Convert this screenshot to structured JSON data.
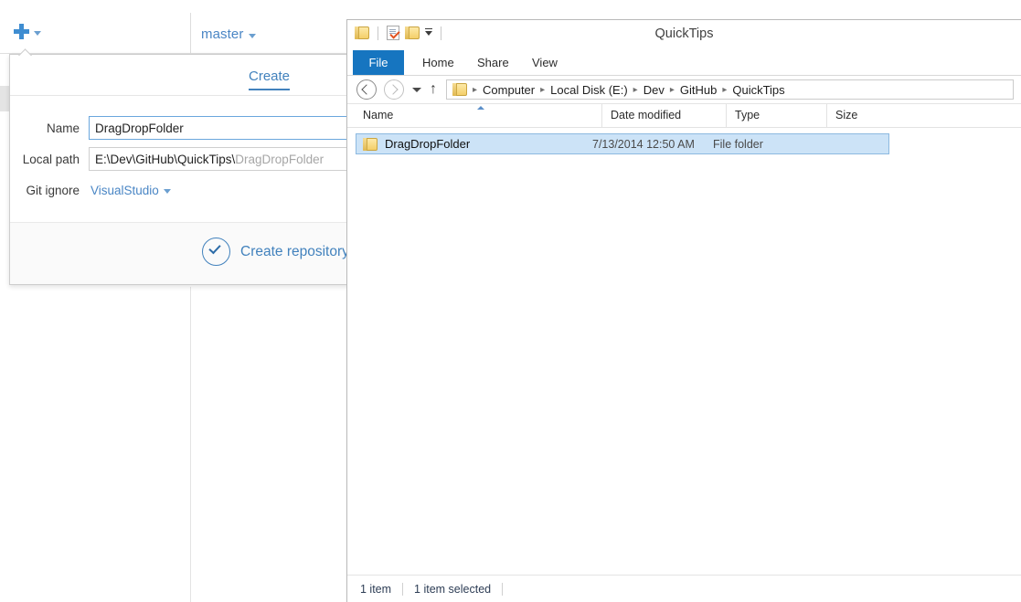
{
  "github_app": {
    "add_button": {
      "icon": "plus-icon",
      "caret": "chevron-down-icon"
    },
    "branch_selector": {
      "label": "master",
      "caret": "chevron-down-icon"
    },
    "popover": {
      "tab_create_label": "Create",
      "fields": [
        {
          "label": "Name",
          "value": "DragDropFolder",
          "placeholder": "Name"
        },
        {
          "label": "Local path",
          "value_strong": "E:\\Dev\\GitHub\\QuickTips\\",
          "value_dim": "DragDropFolder",
          "placeholder": "Local path"
        },
        {
          "label": "Git ignore",
          "value": "VisualStudio"
        }
      ],
      "primary_action_label": "Create repository"
    },
    "colors": {
      "accent": "#4282bd",
      "plus": "#3f8dd1",
      "link": "#4a86c5"
    }
  },
  "explorer": {
    "window_title": "QuickTips",
    "quick_access_toolbar": [
      {
        "name": "folder-icon"
      },
      {
        "name": "properties-icon"
      },
      {
        "name": "new-folder-icon"
      },
      {
        "name": "customize-qat-caret-icon"
      }
    ],
    "ribbon_tabs": [
      {
        "label": "File",
        "active": true
      },
      {
        "label": "Home",
        "active": false
      },
      {
        "label": "Share",
        "active": false
      },
      {
        "label": "View",
        "active": false
      }
    ],
    "navigation": {
      "back_icon": "arrow-left-icon",
      "forward_icon": "arrow-right-icon",
      "recent_icon": "chevron-down-icon",
      "up_icon": "arrow-up-icon",
      "breadcrumbs": [
        "Computer",
        "Local Disk (E:)",
        "Dev",
        "GitHub",
        "QuickTips"
      ],
      "separator": "▸"
    },
    "columns": [
      {
        "label": "Name",
        "sorted": "asc"
      },
      {
        "label": "Date modified"
      },
      {
        "label": "Type"
      },
      {
        "label": "Size"
      }
    ],
    "rows": [
      {
        "icon": "folder-icon",
        "name": "DragDropFolder",
        "date_modified": "7/13/2014 12:50 AM",
        "type": "File folder",
        "size": "",
        "selected": true
      }
    ],
    "status_bar": {
      "item_count": "1 item",
      "selection": "1 item selected"
    },
    "colors": {
      "file_tab": "#1675c0",
      "selection_fill": "#cce3f7",
      "selection_border": "#8cb9e0"
    }
  }
}
